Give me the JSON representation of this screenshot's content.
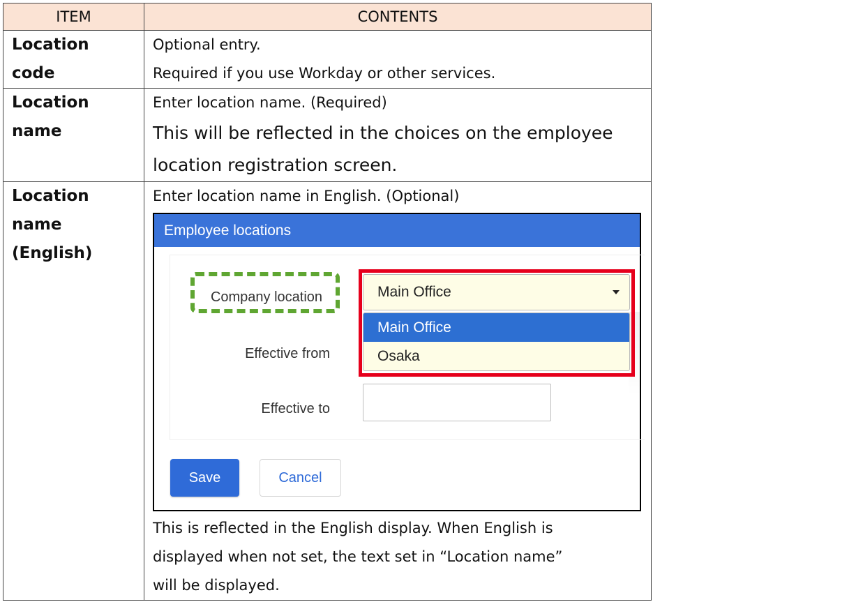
{
  "table": {
    "headers": [
      "ITEM",
      "CONTENTS"
    ],
    "rows": [
      {
        "item": [
          "Location",
          "code"
        ],
        "content": [
          "Optional entry.",
          "Required if you use Workday or other services."
        ]
      },
      {
        "item": [
          "Location",
          "name"
        ],
        "content": [
          "Enter location name. (Required)"
        ],
        "content_large": [
          "This will be reflected in the choices on the employee",
          "location registration screen."
        ]
      },
      {
        "item": [
          "Location",
          "name",
          "(English)"
        ],
        "content_top": "Enter location name in English. (Optional)",
        "content_bottom": [
          "This is reflected in the English display. When English is",
          "displayed when not set, the text set in “Location name”",
          "will be displayed."
        ]
      }
    ]
  },
  "screenshot": {
    "title": "Employee locations",
    "company_location_label": "Company location",
    "effective_from_label": "Effective from",
    "effective_to_label": "Effective to",
    "select_value": "Main Office",
    "options": [
      "Main Office",
      "Osaka"
    ],
    "selected_option": "Main Office",
    "save_label": "Save",
    "cancel_label": "Cancel",
    "colors": {
      "header_bg": "#3a73d9",
      "highlight_red": "#e6001c",
      "highlight_green": "#5fa632",
      "option_selected": "#2d6fd2",
      "table_header_bg": "#fbe3d4"
    }
  }
}
